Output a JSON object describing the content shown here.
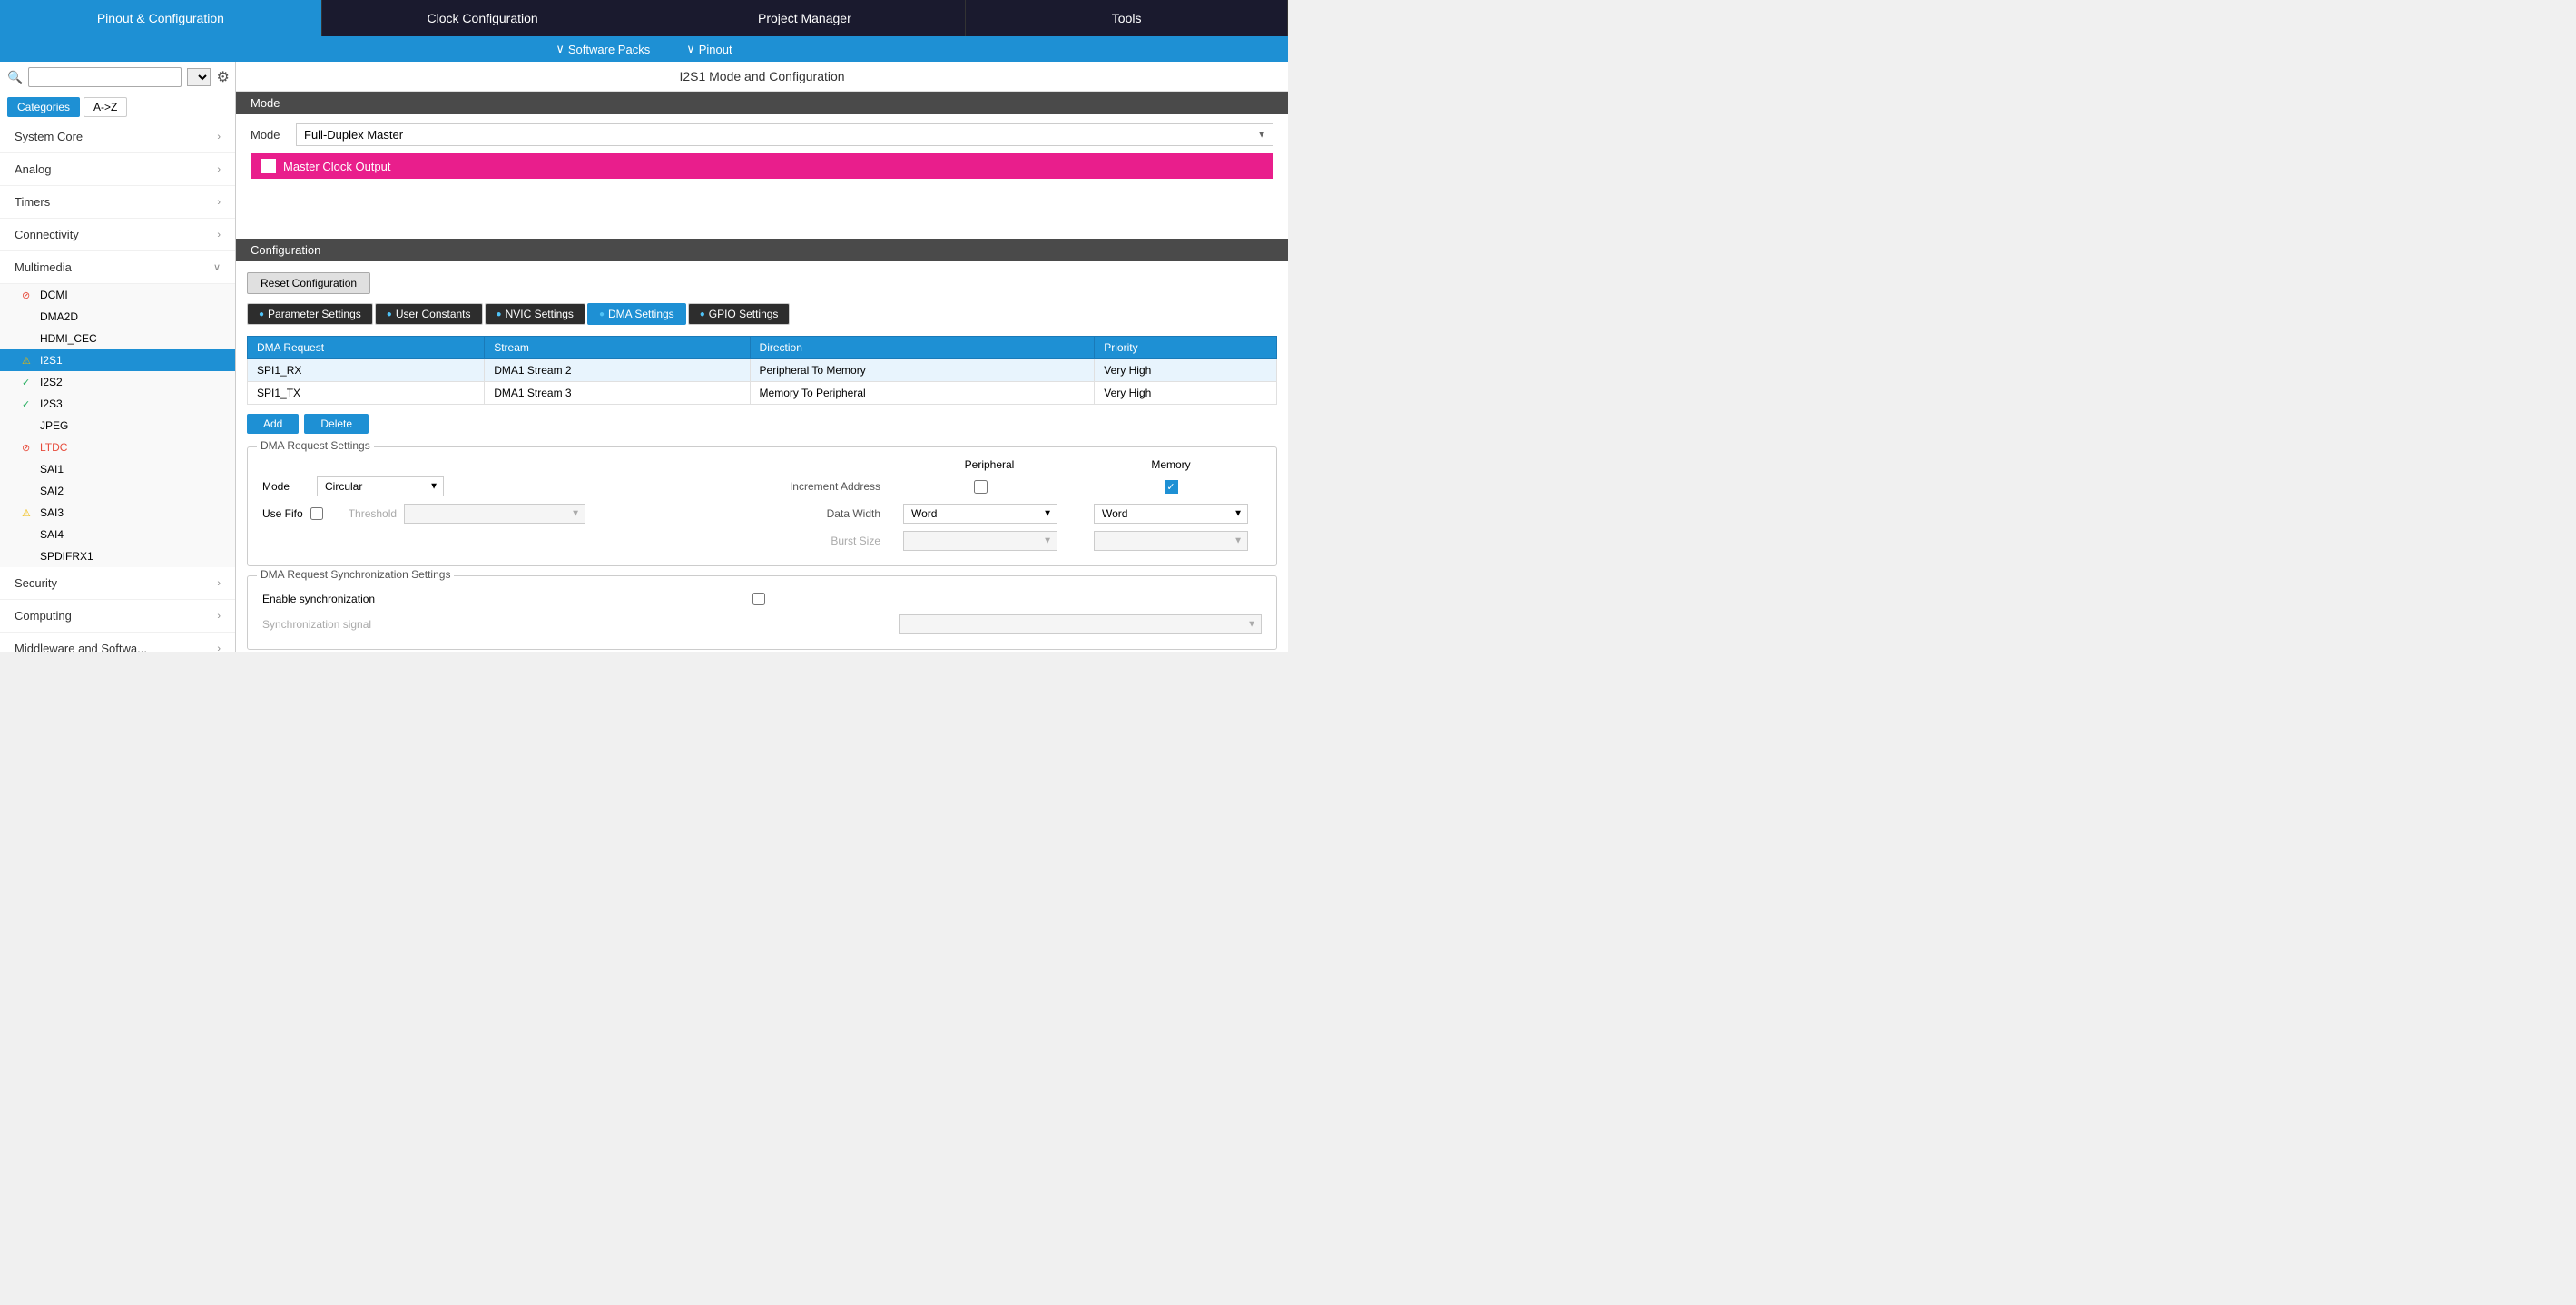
{
  "topNav": {
    "items": [
      {
        "label": "Pinout & Configuration",
        "active": true
      },
      {
        "label": "Clock Configuration",
        "active": false
      },
      {
        "label": "Project Manager",
        "active": false
      },
      {
        "label": "Tools",
        "active": false
      }
    ]
  },
  "subNav": {
    "items": [
      {
        "label": "Software Packs",
        "hasArrow": true
      },
      {
        "label": "Pinout",
        "hasArrow": true
      }
    ]
  },
  "sidebar": {
    "searchPlaceholder": "",
    "tabs": [
      {
        "label": "Categories",
        "active": true
      },
      {
        "label": "A->Z",
        "active": false
      }
    ],
    "categories": [
      {
        "label": "System Core",
        "expanded": false
      },
      {
        "label": "Analog",
        "expanded": false
      },
      {
        "label": "Timers",
        "expanded": false
      },
      {
        "label": "Connectivity",
        "expanded": false
      },
      {
        "label": "Multimedia",
        "expanded": true
      },
      {
        "label": "Security",
        "expanded": false
      },
      {
        "label": "Computing",
        "expanded": false
      },
      {
        "label": "Middleware and Softwa...",
        "expanded": false
      }
    ],
    "multimediaItems": [
      {
        "label": "DCMI",
        "status": "error"
      },
      {
        "label": "DMA2D",
        "status": "none"
      },
      {
        "label": "HDMI_CEC",
        "status": "none"
      },
      {
        "label": "I2S1",
        "status": "warning",
        "selected": true
      },
      {
        "label": "I2S2",
        "status": "ok"
      },
      {
        "label": "I2S3",
        "status": "ok"
      },
      {
        "label": "JPEG",
        "status": "none"
      },
      {
        "label": "LTDC",
        "status": "error"
      },
      {
        "label": "SAI1",
        "status": "none"
      },
      {
        "label": "SAI2",
        "status": "none"
      },
      {
        "label": "SAI3",
        "status": "warning"
      },
      {
        "label": "SAI4",
        "status": "none"
      },
      {
        "label": "SPDIFRX1",
        "status": "none"
      }
    ]
  },
  "contentTitle": "I2S1 Mode and Configuration",
  "modeSection": {
    "header": "Mode",
    "modeLabel": "Mode",
    "modeValue": "Full-Duplex Master",
    "masterClockLabel": "Master Clock Output"
  },
  "configSection": {
    "header": "Configuration",
    "resetBtnLabel": "Reset Configuration",
    "tabs": [
      {
        "label": "Parameter Settings",
        "active": false
      },
      {
        "label": "User Constants",
        "active": false
      },
      {
        "label": "NVIC Settings",
        "active": false
      },
      {
        "label": "DMA Settings",
        "active": true
      },
      {
        "label": "GPIO Settings",
        "active": false
      }
    ]
  },
  "dmaTable": {
    "headers": [
      "DMA Request",
      "Stream",
      "Direction",
      "Priority"
    ],
    "rows": [
      {
        "request": "SPI1_RX",
        "stream": "DMA1 Stream 2",
        "direction": "Peripheral To Memory",
        "priority": "Very High"
      },
      {
        "request": "SPI1_TX",
        "stream": "DMA1 Stream 3",
        "direction": "Memory To Peripheral",
        "priority": "Very High"
      }
    ]
  },
  "actionBtns": {
    "addLabel": "Add",
    "deleteLabel": "Delete"
  },
  "dmaRequestSettings": {
    "title": "DMA Request Settings",
    "peripheralLabel": "Peripheral",
    "memoryLabel": "Memory",
    "modeLabel": "Mode",
    "modeValue": "Circular",
    "incrementAddressLabel": "Increment Address",
    "peripheralChecked": false,
    "memoryChecked": true,
    "useFifoLabel": "Use Fifo",
    "useFifoChecked": false,
    "thresholdLabel": "Threshold",
    "thresholdValue": "",
    "dataWidthLabel": "Data Width",
    "dataWidthPeripheral": "Word",
    "dataWidthMemory": "Word",
    "burstSizeLabel": "Burst Size",
    "burstSizePeripheral": "",
    "burstSizeMemory": ""
  },
  "dmaSyncSettings": {
    "title": "DMA Request Synchronization Settings",
    "enableSyncLabel": "Enable synchronization",
    "enableSyncChecked": false,
    "syncSignalLabel": "Synchronization signal",
    "syncSignalValue": ""
  }
}
